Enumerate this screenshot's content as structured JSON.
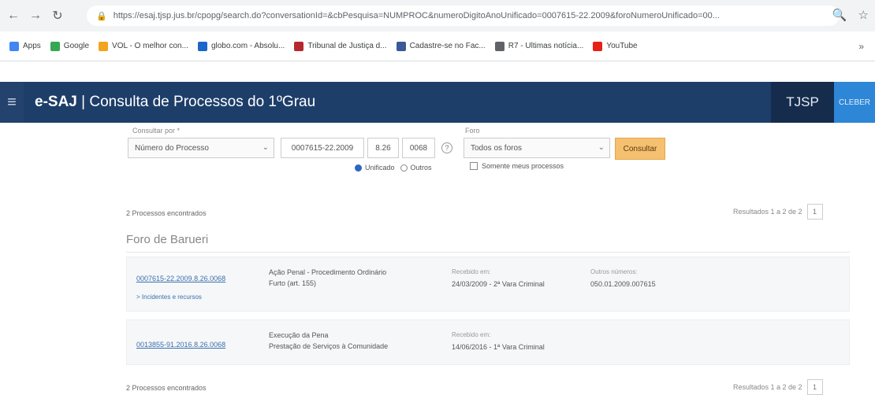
{
  "browser": {
    "url": "https://esaj.tjsp.jus.br/cpopg/search.do?conversationId=&cbPesquisa=NUMPROC&numeroDigitoAnoUnificado=0007615-22.2009&foroNumeroUnificado=00...",
    "bookmarks": [
      {
        "label": "Apps",
        "color": "#4285f4"
      },
      {
        "label": "Google",
        "color": "#34a853"
      },
      {
        "label": "VOL - O melhor con...",
        "color": "#f4a31c"
      },
      {
        "label": "globo.com - Absolu...",
        "color": "#1a66c9"
      },
      {
        "label": "Tribunal de Justiça d...",
        "color": "#b5292e"
      },
      {
        "label": "Cadastre-se no Fac...",
        "color": "#3b5998"
      },
      {
        "label": "R7 - Ultimas notícia...",
        "color": "#5f6368"
      },
      {
        "label": "YouTube",
        "color": "#e62117"
      }
    ]
  },
  "header": {
    "brand": "e-SAJ",
    "title": " | Consulta de Processos do 1ºGrau",
    "court": "TJSP",
    "user": "CLEBER"
  },
  "search": {
    "query_label": "Consultar por *",
    "query_type": "Número do Processo",
    "number_part": "0007615-22.2009",
    "segment_part": "8.26",
    "forum_part": "0068",
    "foro_label": "Foro",
    "foro_value": "Todos os foros",
    "button_label": "Consultar",
    "radio_unified": "Unificado",
    "radio_other": "Outros",
    "checkbox_label": "Somente meus processos"
  },
  "results": {
    "count_text": "2 Processos encontrados",
    "pagination_text": "Resultados 1 a 2 de 2",
    "page_number": "1",
    "forum_title": "Foro de Barueri",
    "rows": [
      {
        "number": "0007615-22.2009.8.26.0068",
        "sub_link": "> Incidentes e recursos",
        "class_line1": "Ação Penal - Procedimento Ordinário",
        "class_line2": "Furto (art. 155)",
        "dist_label": "Recebido em:",
        "dist_value": "24/03/2009 - 2ª Vara Criminal",
        "other_label": "Outros números:",
        "other_value": "050.01.2009.007615"
      },
      {
        "number": "0013855-91.2016.8.26.0068",
        "class_line1": "Execução da Pena",
        "class_line2": "Prestação de Serviços à Comunidade",
        "dist_label": "Recebido em:",
        "dist_value": "14/06/2016 - 1ª Vara Criminal"
      }
    ],
    "footer_count_text": "2 Processos encontrados",
    "footer_pagination_text": "Resultados 1 a 2 de 2",
    "footer_page_number": "1"
  }
}
